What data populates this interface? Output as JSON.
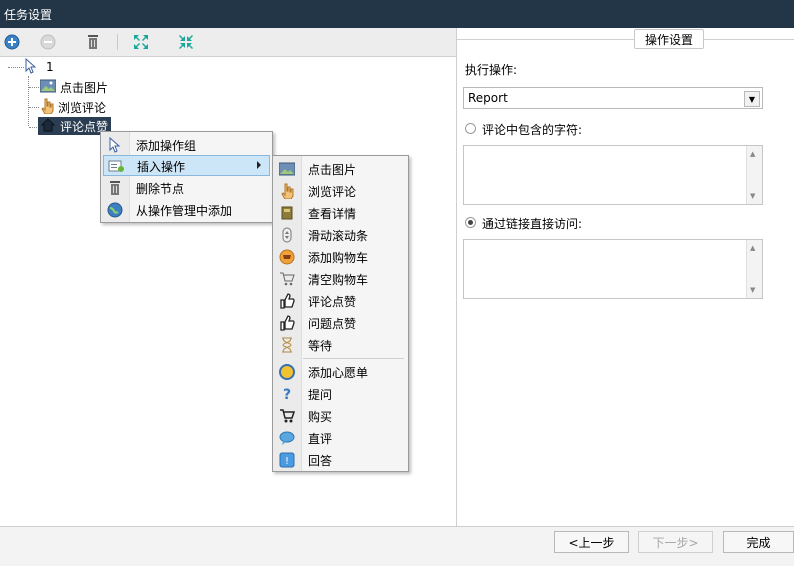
{
  "window": {
    "title": "任务设置"
  },
  "toolbar": {
    "icons": [
      "add-icon",
      "remove-disabled-icon",
      "trash-icon",
      "expand-icon",
      "collapse-icon"
    ]
  },
  "tree": {
    "root": {
      "label": "1"
    },
    "children": [
      {
        "label": "点击图片",
        "icon": "image-icon"
      },
      {
        "label": "浏览评论",
        "icon": "hand-icon"
      },
      {
        "label": "评论点赞",
        "icon": "house-icon",
        "selected": true
      }
    ]
  },
  "context_menu": {
    "items": [
      {
        "label": "添加操作组",
        "icon": "cursor-icon"
      },
      {
        "label": "插入操作",
        "icon": "insert-icon",
        "highlighted": true,
        "has_submenu": true
      },
      {
        "label": "删除节点",
        "icon": "trash-icon"
      },
      {
        "label": "从操作管理中添加",
        "icon": "globe-icon"
      }
    ]
  },
  "submenu": {
    "items": [
      {
        "label": "点击图片",
        "icon": "image-icon"
      },
      {
        "label": "浏览评论",
        "icon": "hand-icon"
      },
      {
        "label": "查看详情",
        "icon": "book-icon"
      },
      {
        "label": "滑动滚动条",
        "icon": "scroll-icon"
      },
      {
        "label": "添加购物车",
        "icon": "cart-add-icon"
      },
      {
        "label": "清空购物车",
        "icon": "cart-icon"
      },
      {
        "label": "评论点赞",
        "icon": "thumbs-up-icon"
      },
      {
        "label": "问题点赞",
        "icon": "thumbs-up-icon"
      },
      {
        "label": "等待",
        "icon": "hourglass-icon"
      },
      {
        "label": "添加心愿单",
        "icon": "wishlist-icon"
      },
      {
        "label": "提问",
        "icon": "question-icon"
      },
      {
        "label": "购买",
        "icon": "cart-buy-icon"
      },
      {
        "label": "直评",
        "icon": "chat-icon"
      },
      {
        "label": "回答",
        "icon": "answer-icon"
      }
    ]
  },
  "panel": {
    "group_title": "操作设置",
    "action_label": "执行操作:",
    "action_value": "Report",
    "option_contains": {
      "label": "评论中包含的字符:",
      "checked": false
    },
    "option_link": {
      "label": "通过链接直接访问:",
      "checked": true
    }
  },
  "footer": {
    "prev": "<上一步",
    "next": "下一步>",
    "finish": "完成"
  },
  "colors": {
    "titlebar": "#233647",
    "highlight": "#cde6f7",
    "selection": "#2a3d52"
  }
}
